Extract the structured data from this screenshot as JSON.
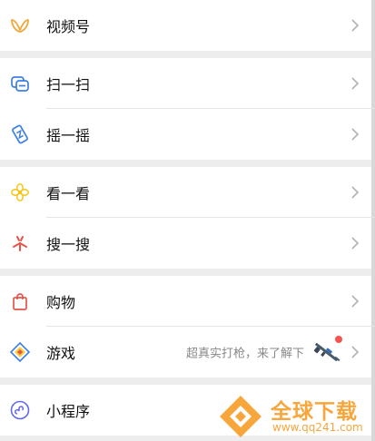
{
  "menu": {
    "groups": [
      {
        "items": [
          {
            "label": "视频号",
            "icon": "channels-icon"
          }
        ]
      },
      {
        "items": [
          {
            "label": "扫一扫",
            "icon": "scan-icon"
          },
          {
            "label": "摇一摇",
            "icon": "shake-icon"
          }
        ]
      },
      {
        "items": [
          {
            "label": "看一看",
            "icon": "top-stories-icon"
          },
          {
            "label": "搜一搜",
            "icon": "search-icon"
          }
        ]
      },
      {
        "items": [
          {
            "label": "购物",
            "icon": "shopping-bag-icon"
          },
          {
            "label": "游戏",
            "icon": "game-icon",
            "promo": "超真实打枪，来了解下",
            "badge_icon": "rifle-icon",
            "has_red_dot": true
          }
        ]
      },
      {
        "items": [
          {
            "label": "小程序",
            "icon": "mini-programs-icon"
          }
        ]
      }
    ]
  },
  "watermark": {
    "title": "全球下载",
    "url": "www.qq241.com"
  },
  "colors": {
    "channels": "#f0a73a",
    "scan": "#3d7ee5",
    "shake": "#3d7ee5",
    "top_stories": "#f5c518",
    "search": "#e8534a",
    "shopping": "#e2574c",
    "game": "#3d7ee5",
    "mini_programs": "#6467f0",
    "watermark": "#f7a63c"
  }
}
